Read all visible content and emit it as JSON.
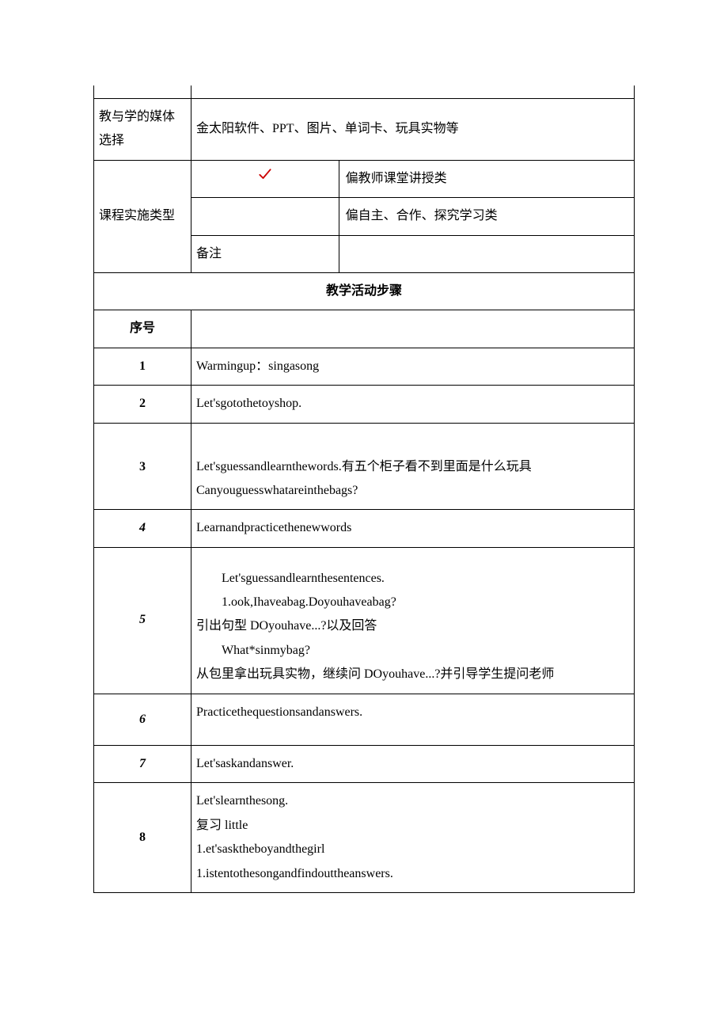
{
  "row_empty": "",
  "media_label": "教与学的媒体选择",
  "media_content": "金太阳软件、PPT、图片、单词卡、玩具实物等",
  "impl_label": "课程实施类型",
  "impl_type1": "偏教师课堂讲授类",
  "impl_type2": "偏自主、合作、探究学习类",
  "remark_label": "备注",
  "remark_content": "",
  "steps_header": "教学活动步骤",
  "seq_header": "序号",
  "steps": {
    "1": {
      "seq": "1",
      "content": "Warmingup：singasong"
    },
    "2": {
      "seq": "2",
      "content": "Let'sgotothetoyshop."
    },
    "3": {
      "seq": "3",
      "line1": "Let'sguessandlearnthewords.有五个柜子看不到里面是什么玩具",
      "line2": "Canyouguesswhatareinthebags?"
    },
    "4": {
      "seq": "4",
      "content": "Learnandpracticethenewwords"
    },
    "5": {
      "seq": "5",
      "line1": "Let'sguessandlearnthesentences.",
      "line2": "1.ook,Ihaveabag.Doyouhaveabag?",
      "line3": "引出句型 DOyouhave...?以及回答",
      "line4": "What*sinmybag?",
      "line5": "从包里拿出玩具实物，继续问 DOyouhave...?并引导学生提问老师"
    },
    "6": {
      "seq": "6",
      "content": "Practicethequestionsandanswers."
    },
    "7": {
      "seq": "7",
      "content": "Let'saskandanswer."
    },
    "8": {
      "seq": "8",
      "line1": "Let'slearnthesong.",
      "line2": "复习 little",
      "line3": "1.et'sasktheboyandthegirl",
      "line4": "1.istentothesongandfindouttheanswers."
    }
  }
}
